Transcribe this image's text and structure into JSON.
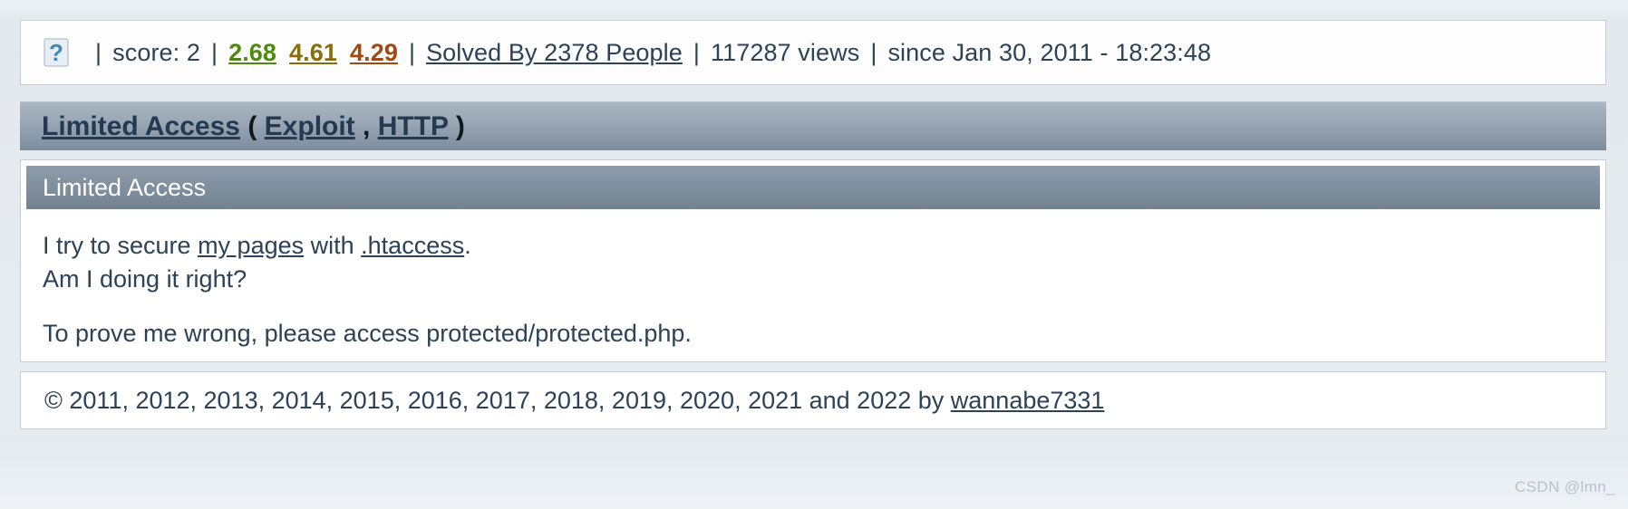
{
  "meta": {
    "icon": "question-mark-favicon",
    "score_label": "score: 2",
    "rating_1": "2.68",
    "rating_2": "4.61",
    "rating_3": "4.29",
    "rating_1_color": "#4f8a10",
    "rating_2_color": "#8a6d0b",
    "rating_3_color": "#9e4a12",
    "solved_by": "Solved By 2378 People",
    "views": "117287 views",
    "since": "since Jan 30, 2011 - 18:23:48",
    "separator": "|"
  },
  "title": {
    "name": "Limited Access",
    "open_paren": "(",
    "tag_1": "Exploit",
    "comma": ", ",
    "tag_2": "HTTP",
    "close_paren": ")"
  },
  "panel": {
    "header": "Limited Access",
    "line_1_a": "I try to secure ",
    "line_1_link_1": "my pages",
    "line_1_b": " with ",
    "line_1_link_2": ".htaccess",
    "line_1_c": ".",
    "line_2": "Am I doing it right?",
    "line_3": "To prove me wrong, please access protected/protected.php."
  },
  "footer": {
    "copyright": "© 2011, 2012, 2013, 2014, 2015, 2016, 2017, 2018, 2019, 2020, 2021 and 2022 by ",
    "author": "wannabe7331"
  },
  "watermark": {
    "text": "CSDN @lmn_"
  }
}
